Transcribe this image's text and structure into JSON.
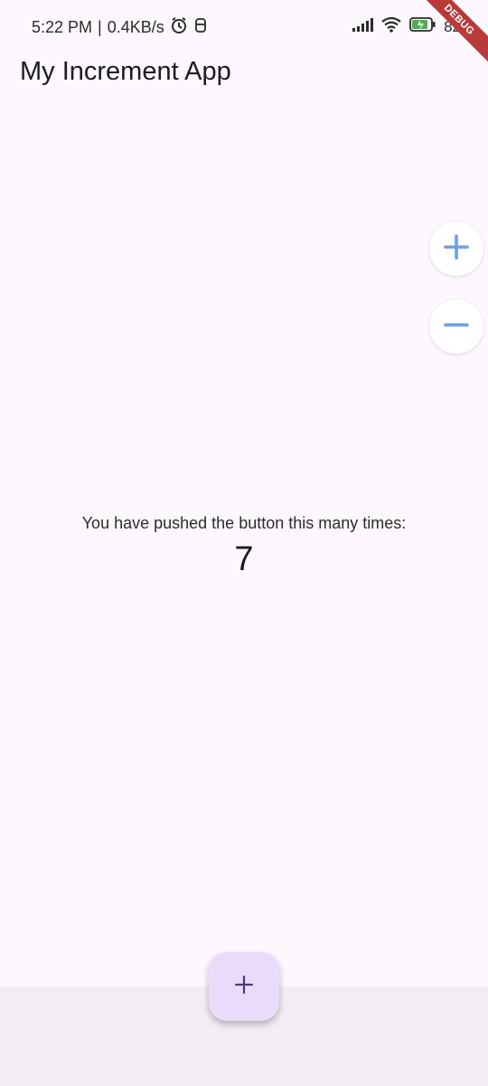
{
  "status_bar": {
    "time": "5:22 PM",
    "network_speed": "0.4KB/s",
    "battery": "82",
    "icons": [
      "alarm-icon",
      "notification-icon",
      "signal-icon",
      "wifi-icon",
      "battery-charging-icon"
    ]
  },
  "debug_banner": "DEBUG",
  "app_bar": {
    "title": "My Increment App"
  },
  "side_buttons": {
    "plus_icon": "plus-icon",
    "minus_icon": "minus-icon",
    "color": "#6e9fe8"
  },
  "counter": {
    "label": "You have pushed the button this many times:",
    "value": "7"
  },
  "fab": {
    "icon": "plus-icon",
    "color": "#4a3b7a"
  },
  "colors": {
    "background": "#fdf7fe",
    "fab": "#e9dcfa",
    "bottom_bar": "#f2ecf4"
  }
}
